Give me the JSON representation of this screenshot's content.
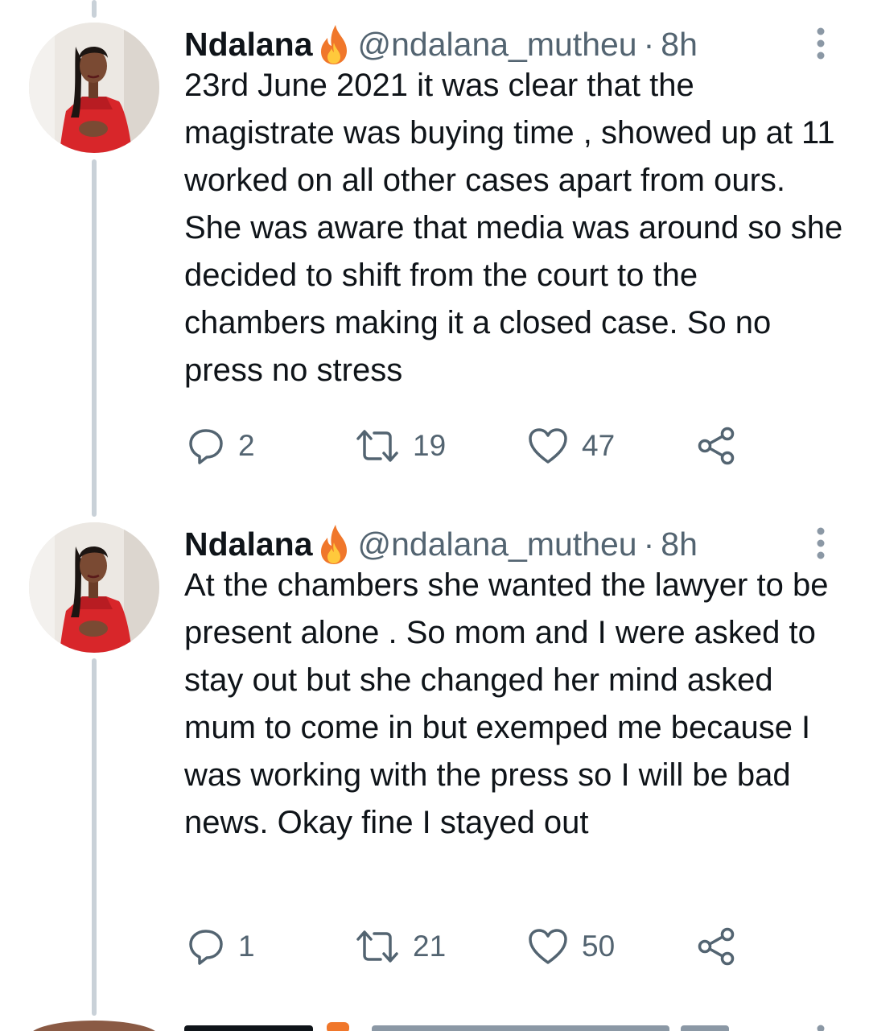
{
  "thread": {
    "tweets": [
      {
        "display_name": "Ndalana",
        "name_emoji": "fire-icon",
        "handle": "@ndalana_mutheu",
        "separator": "·",
        "time": "8h",
        "text": "23rd June 2021 it was clear that the magistrate was buying time , showed up at 11 worked on all other cases apart from ours. She was aware that media was around so she decided to shift from the court to the chambers making it a closed case. So no press no stress",
        "replies": "2",
        "retweets": "19",
        "likes": "47"
      },
      {
        "display_name": "Ndalana",
        "name_emoji": "fire-icon",
        "handle": "@ndalana_mutheu",
        "separator": "·",
        "time": "8h",
        "text": "At the chambers she wanted the lawyer to be present alone . So mom and I were asked to stay out but she changed her mind asked mum to come in but exemped me because I was working with the press so I will be bad news. Okay fine I stayed out",
        "replies": "1",
        "retweets": "21",
        "likes": "50"
      }
    ]
  },
  "colors": {
    "text_primary": "#0f1419",
    "text_secondary": "#536471",
    "thread_line": "#c9d1d8",
    "avatar_dress": "#d8262a",
    "fire_outer": "#f0772b",
    "fire_inner": "#ffc93c"
  }
}
